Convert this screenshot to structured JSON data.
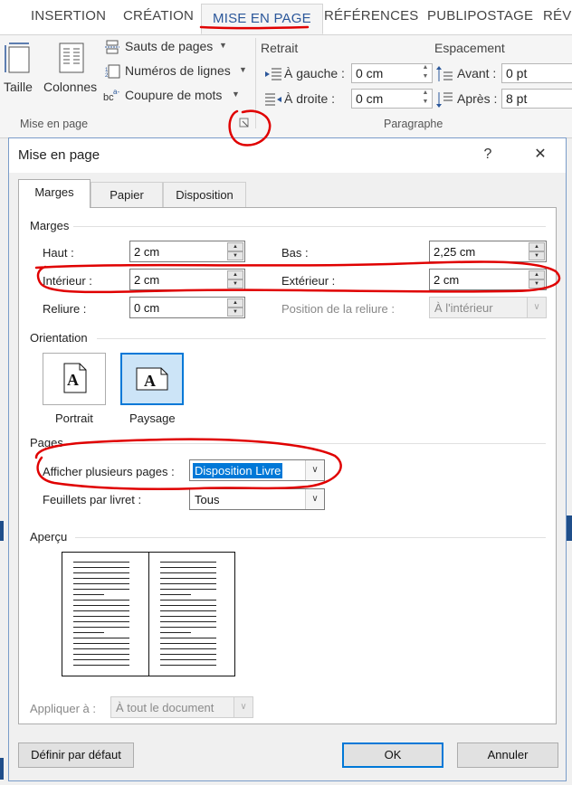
{
  "ribbon": {
    "tabs": [
      "INSERTION",
      "CRÉATION",
      "MISE EN PAGE",
      "RÉFÉRENCES",
      "PUBLIPOSTAGE",
      "RÉVI"
    ],
    "active_tab": "MISE EN PAGE",
    "taille_label": "Taille",
    "colonnes_label": "Colonnes",
    "sauts_label": "Sauts de pages",
    "numeros_label": "Numéros de lignes",
    "coupure_label": "Coupure de mots",
    "group_mise_en_page": "Mise en page",
    "retrait_label": "Retrait",
    "gauche_label": "À gauche :",
    "gauche_value": "0 cm",
    "droite_label": "À droite :",
    "droite_value": "0 cm",
    "espacement_label": "Espacement",
    "avant_label": "Avant :",
    "avant_value": "0  pt",
    "apres_label": "Après :",
    "apres_value": "8  pt",
    "group_paragraphe": "Paragraphe"
  },
  "dialog": {
    "title": "Mise en page",
    "help": "?",
    "close": "✕",
    "tabs": [
      "Marges",
      "Papier",
      "Disposition"
    ],
    "marges_section": "Marges",
    "haut_label": "Haut :",
    "haut_value": "2 cm",
    "bas_label": "Bas :",
    "bas_value": "2,25 cm",
    "interieur_label": "Intérieur :",
    "interieur_value": "2 cm",
    "exterieur_label": "Extérieur :",
    "exterieur_value": "2 cm",
    "reliure_label": "Reliure :",
    "reliure_value": "0 cm",
    "position_reliure_label": "Position de la reliure :",
    "position_reliure_value": "À l'intérieur",
    "orientation_section": "Orientation",
    "portrait_label": "Portrait",
    "paysage_label": "Paysage",
    "pages_section": "Pages",
    "afficher_label": "Afficher plusieurs pages :",
    "afficher_value": "Disposition Livre",
    "feuillets_label": "Feuillets par livret :",
    "feuillets_value": "Tous",
    "apercu_section": "Aperçu",
    "appliquer_label": "Appliquer à :",
    "appliquer_value": "À tout le document",
    "definir_button": "Définir par défaut",
    "ok_button": "OK",
    "annuler_button": "Annuler"
  },
  "colors": {
    "accent": "#2b579a",
    "selection": "#0078d7",
    "annotation": "#e00000"
  }
}
